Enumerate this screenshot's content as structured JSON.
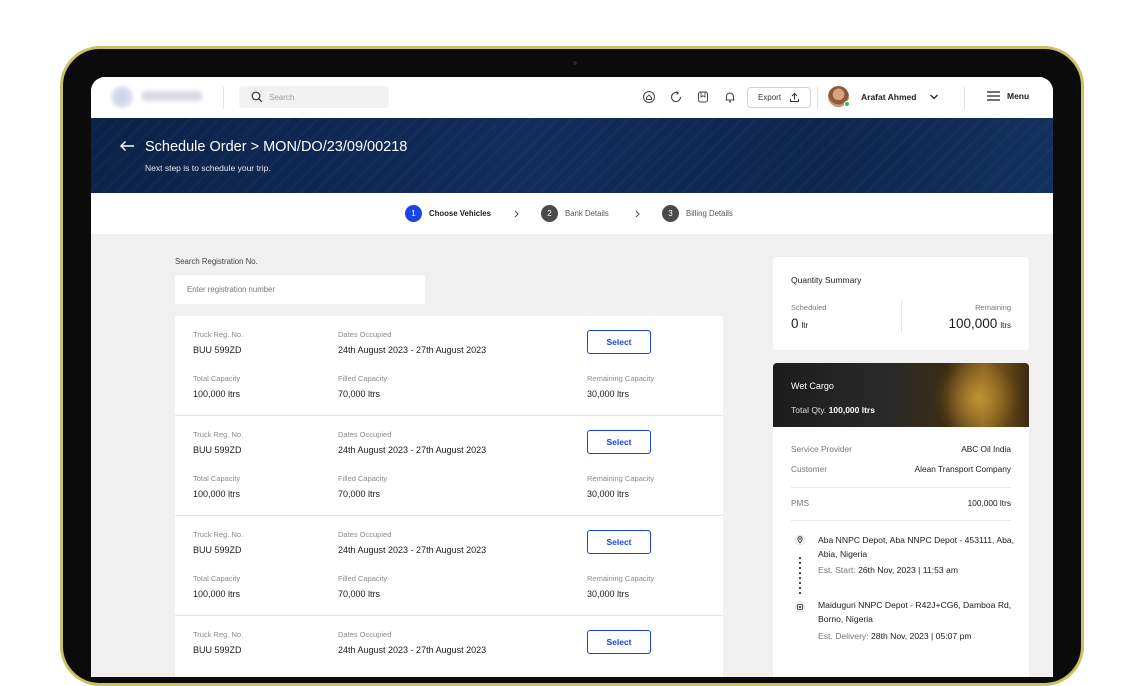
{
  "topbar": {
    "search_placeholder": "Search",
    "export_label": "Export",
    "user_name": "Arafat Ahmed",
    "menu_label": "Menu"
  },
  "header": {
    "title": "Schedule Order > MON/DO/23/09/00218",
    "subtitle": "Next step is to schedule your trip."
  },
  "stepper": {
    "steps": [
      {
        "num": "1",
        "label": "Choose Vehicles"
      },
      {
        "num": "2",
        "label": "Bank Details"
      },
      {
        "num": "3",
        "label": "Billing Details"
      }
    ]
  },
  "search": {
    "label": "Search Registration No.",
    "placeholder": "Enter registration number"
  },
  "card_labels": {
    "truck_reg": "Truck Reg. No.",
    "dates": "Dates Occupied",
    "total": "Total Capacity",
    "filled": "Filled Capacity",
    "remaining": "Remaining Capacity",
    "select": "Select"
  },
  "vehicles": [
    {
      "reg": "BUU 599ZD",
      "dates": "24th August 2023 - 27th August 2023",
      "total": "100,000 ltrs",
      "filled": "70,000 ltrs",
      "remaining": "30,000 ltrs"
    },
    {
      "reg": "BUU 599ZD",
      "dates": "24th August 2023 - 27th August 2023",
      "total": "100,000 ltrs",
      "filled": "70,000 ltrs",
      "remaining": "30,000 ltrs"
    },
    {
      "reg": "BUU 599ZD",
      "dates": "24th August 2023 - 27th August 2023",
      "total": "100,000 ltrs",
      "filled": "70,000 ltrs",
      "remaining": "30,000 ltrs"
    },
    {
      "reg": "BUU 599ZD",
      "dates": "24th August 2023 - 27th August 2023",
      "total": "",
      "filled": "",
      "remaining": ""
    }
  ],
  "quantity": {
    "title": "Quantity Summary",
    "scheduled_label": "Scheduled",
    "scheduled_value": "0",
    "scheduled_unit": "ltr",
    "remaining_label": "Remaining",
    "remaining_value": "100,000",
    "remaining_unit": "ltrs"
  },
  "cargo": {
    "title": "Wet Cargo",
    "total_label": "Total Qty.",
    "total_value": "100,000 ltrs"
  },
  "details": {
    "provider_label": "Service Provider",
    "provider_value": "ABC Oil India",
    "customer_label": "Customer",
    "customer_value": "Alean Transport Company",
    "product_label": "PMS",
    "product_value": "100,000 ltrs",
    "origin": "Aba NNPC Depot, Aba NNPC Depot - 453111, Aba, Abia, Nigeria",
    "start_label": "Est. Start:",
    "start_value": "26th Nov, 2023 | 11:53 am",
    "destination": "Maiduguri NNPC Depot - R42J+CG6, Damboa Rd, Borno, Nigeria",
    "delivery_label": "Est. Delivery:",
    "delivery_value": "28th Nov, 2023 | 05:07 pm"
  },
  "colors": {
    "accent": "#1b43e8",
    "banner": "#0f2750",
    "online": "#2ebd5a"
  }
}
